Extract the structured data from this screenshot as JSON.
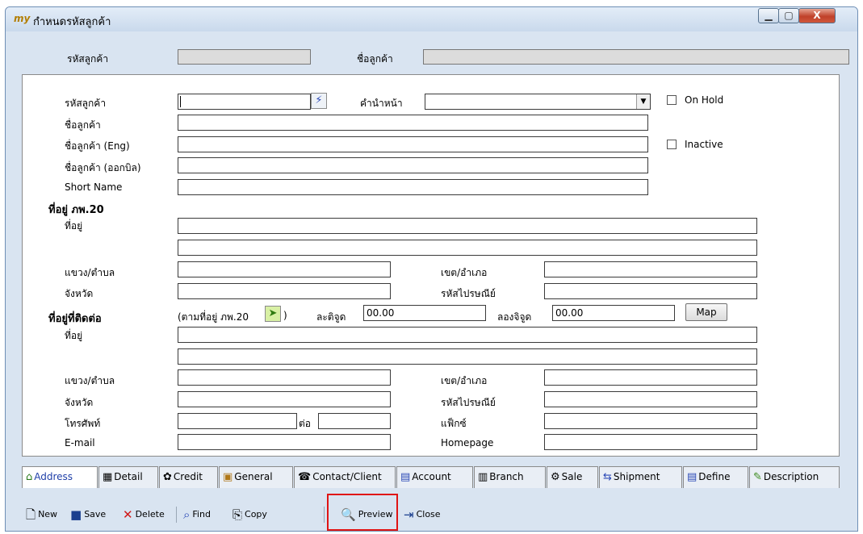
{
  "window": {
    "title": "กำหนดรหัสลูกค้า",
    "app_icon": "my",
    "controls": {
      "minimize": "▁",
      "maximize": "▢",
      "close": "X"
    }
  },
  "header": {
    "code_label": "รหัสลูกค้า",
    "name_label": "ชื่อลูกค้า",
    "code_value": "",
    "name_value": ""
  },
  "form": {
    "code_label": "รหัสลูกค้า",
    "prefix_label": "คำนำหน้า",
    "prefix_value": "",
    "name_label": "ชื่อลูกค้า",
    "name_eng_label": "ชื่อลูกค้า (Eng)",
    "name_bill_label": "ชื่อลูกค้า (ออกบิล)",
    "short_name_label": "Short Name",
    "on_hold_label": "On Hold",
    "inactive_label": "Inactive",
    "on_hold_checked": false,
    "inactive_checked": false
  },
  "tax_address": {
    "heading": "ที่อยู่ ภพ.20",
    "address_label": "ที่อยู่",
    "subdistrict_label": "แขวง/ตำบล",
    "district_label": "เขต/อำเภอ",
    "province_label": "จังหวัด",
    "postcode_label": "รหัสไปรษณีย์"
  },
  "contact_address": {
    "heading": "ที่อยู่ที่ติดต่อ",
    "copy_hint_prefix": "(ตามที่อยู่ ภพ.20",
    "copy_hint_suffix": ")",
    "latitude_label": "ละติจูด",
    "latitude_value": "00.00",
    "longitude_label": "ลองจิจูด",
    "longitude_value": "00.00",
    "map_button": "Map",
    "address_label": "ที่อยู่",
    "subdistrict_label": "แขวง/ตำบล",
    "district_label": "เขต/อำเภอ",
    "province_label": "จังหวัด",
    "postcode_label": "รหัสไปรษณีย์",
    "phone_label": "โทรศัพท์",
    "ext_label": "ต่อ",
    "fax_label": "แฟ็กซ์",
    "email_label": "E-mail",
    "homepage_label": "Homepage"
  },
  "tabs": [
    {
      "label": "Address",
      "icon": "home-icon",
      "active": true
    },
    {
      "label": "Detail",
      "icon": "detail-icon"
    },
    {
      "label": "Credit",
      "icon": "credit-icon"
    },
    {
      "label": "General",
      "icon": "general-icon"
    },
    {
      "label": "Contact/Client",
      "icon": "contact-icon"
    },
    {
      "label": "Account",
      "icon": "account-icon"
    },
    {
      "label": "Branch",
      "icon": "branch-icon"
    },
    {
      "label": "Sale",
      "icon": "sale-icon"
    },
    {
      "label": "Shipment",
      "icon": "shipment-icon"
    },
    {
      "label": "Define",
      "icon": "define-icon"
    },
    {
      "label": "Description",
      "icon": "description-icon"
    }
  ],
  "toolbar": {
    "new": "New",
    "save": "Save",
    "delete": "Delete",
    "find": "Find",
    "copy": "Copy",
    "preview": "Preview",
    "close": "Close"
  },
  "colors": {
    "window_bg": "#d9e4f1",
    "active_tab_text": "#1f3fa8",
    "highlight": "#e01414"
  }
}
